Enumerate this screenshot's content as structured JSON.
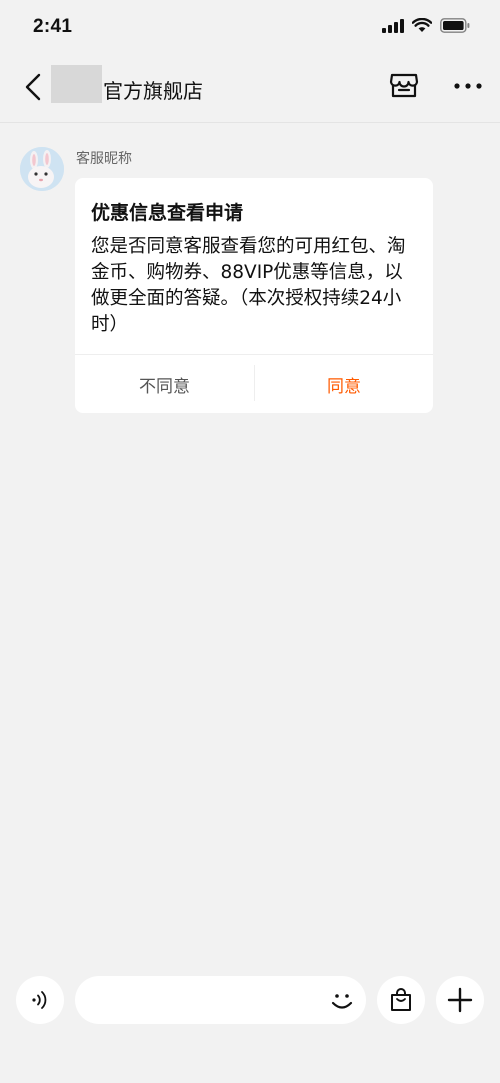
{
  "status_bar": {
    "time": "2:41"
  },
  "nav": {
    "store_name": "官方旗舰店",
    "icons": {
      "back": "chevron-left-icon",
      "shop": "store-icon",
      "more": "more-dots-icon"
    }
  },
  "message": {
    "agent_nickname": "客服昵称",
    "card": {
      "title": "优惠信息查看申请",
      "body": "您是否同意客服查看您的可用红包、淘金币、购物券、88VIP优惠等信息，以做更全面的答疑。（本次授权持续24小时）",
      "decline_label": "不同意",
      "agree_label": "同意"
    }
  },
  "input_bar": {
    "placeholder": "",
    "icons": {
      "voice": "voice-icon",
      "emoji": "smile-icon",
      "bag": "shopping-bag-icon",
      "plus": "plus-icon"
    }
  },
  "colors": {
    "accent": "#ff5a00",
    "background": "#f2f2f2"
  }
}
